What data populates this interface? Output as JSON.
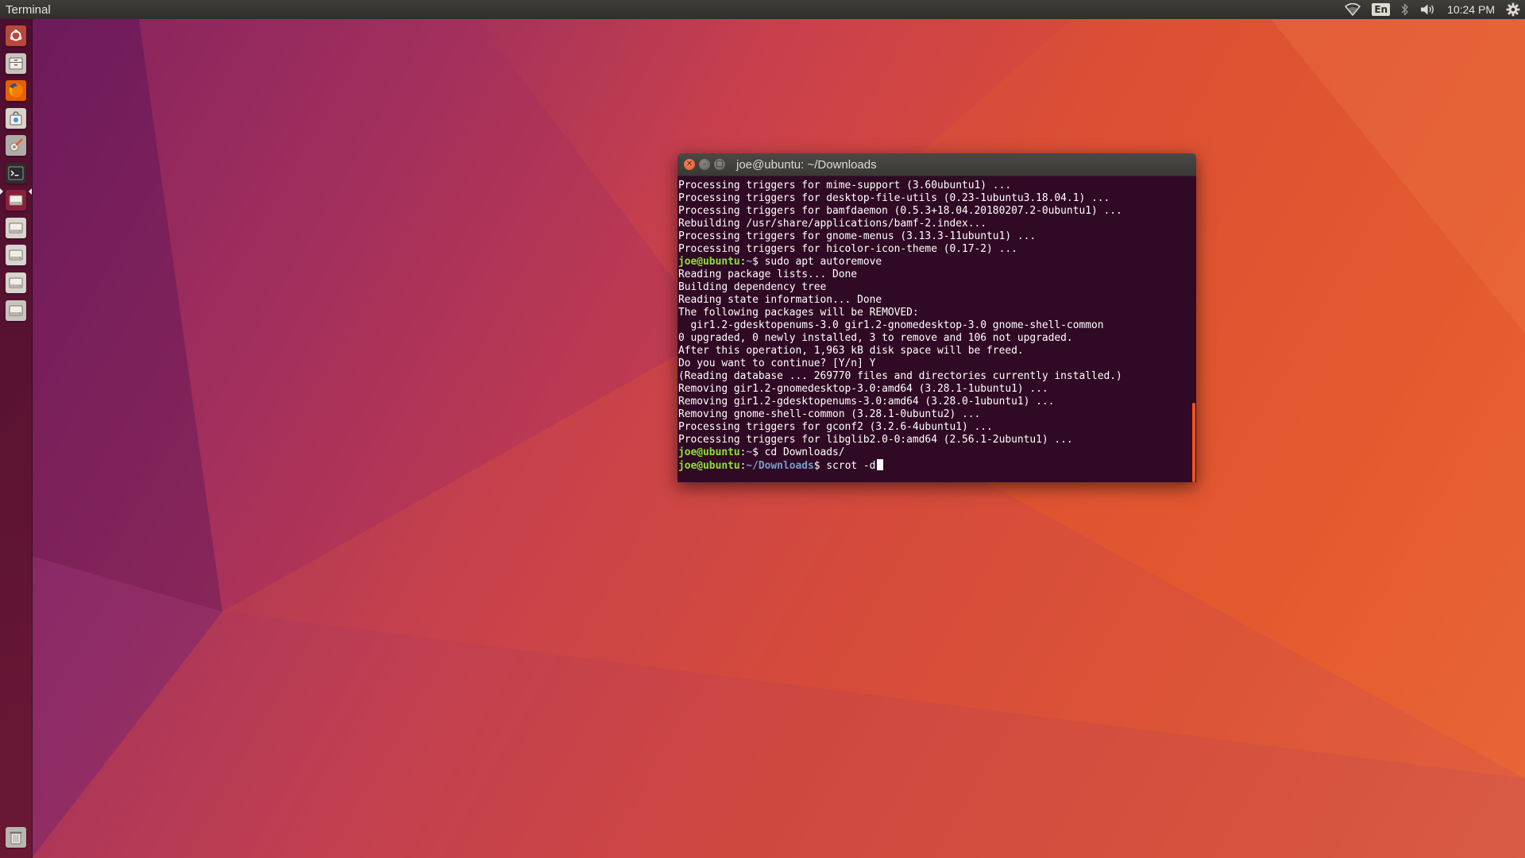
{
  "top_panel": {
    "app_title": "Terminal",
    "language": "En",
    "clock": "10:24 PM",
    "icons": [
      "wifi-icon",
      "keyboard-language-indicator",
      "bluetooth-icon",
      "volume-icon",
      "system-gear-icon"
    ]
  },
  "launcher": {
    "items": [
      {
        "name": "launcher-dash-search",
        "icon": "ubuntu-logo-icon",
        "color": "#b8493a"
      },
      {
        "name": "launcher-files",
        "icon": "file-cabinet-icon",
        "color": "#c9c4bc"
      },
      {
        "name": "launcher-firefox",
        "icon": "firefox-icon",
        "color": "#e66000"
      },
      {
        "name": "launcher-software",
        "icon": "shopping-bag-icon",
        "color": "#d8d3cc"
      },
      {
        "name": "launcher-settings",
        "icon": "wrench-gear-icon",
        "color": "#b0aca6"
      },
      {
        "name": "launcher-terminal",
        "icon": "terminal-icon",
        "color": "#2f2e2b"
      },
      {
        "name": "launcher-drive-1",
        "icon": "drive-icon",
        "color": "#8c1f3a"
      },
      {
        "name": "launcher-drive-2",
        "icon": "drive-icon",
        "color": "#d8d4ce"
      },
      {
        "name": "launcher-drive-3",
        "icon": "drive-icon",
        "color": "#d8d4ce"
      },
      {
        "name": "launcher-drive-4",
        "icon": "drive-icon",
        "color": "#d8d4ce"
      },
      {
        "name": "launcher-drive-5",
        "icon": "drive-icon",
        "color": "#c9c4bc"
      },
      {
        "name": "launcher-trash",
        "icon": "trash-icon",
        "color": "#b8b4ae"
      }
    ]
  },
  "terminal": {
    "title": "joe@ubuntu: ~/Downloads",
    "lines": [
      {
        "type": "out",
        "text": "Processing triggers for mime-support (3.60ubuntu1) ..."
      },
      {
        "type": "out",
        "text": "Processing triggers for desktop-file-utils (0.23-1ubuntu3.18.04.1) ..."
      },
      {
        "type": "out",
        "text": "Processing triggers for bamfdaemon (0.5.3+18.04.20180207.2-0ubuntu1) ..."
      },
      {
        "type": "out",
        "text": "Rebuilding /usr/share/applications/bamf-2.index..."
      },
      {
        "type": "out",
        "text": "Processing triggers for gnome-menus (3.13.3-11ubuntu1) ..."
      },
      {
        "type": "out",
        "text": "Processing triggers for hicolor-icon-theme (0.17-2) ..."
      },
      {
        "type": "prompt",
        "user": "joe@ubuntu",
        "path": "~",
        "cmd": "sudo apt autoremove"
      },
      {
        "type": "out",
        "text": "Reading package lists... Done"
      },
      {
        "type": "out",
        "text": "Building dependency tree"
      },
      {
        "type": "out",
        "text": "Reading state information... Done"
      },
      {
        "type": "out",
        "text": "The following packages will be REMOVED:"
      },
      {
        "type": "out",
        "text": "  gir1.2-gdesktopenums-3.0 gir1.2-gnomedesktop-3.0 gnome-shell-common"
      },
      {
        "type": "out",
        "text": "0 upgraded, 0 newly installed, 3 to remove and 106 not upgraded."
      },
      {
        "type": "out",
        "text": "After this operation, 1,963 kB disk space will be freed."
      },
      {
        "type": "out",
        "text": "Do you want to continue? [Y/n] Y"
      },
      {
        "type": "out",
        "text": "(Reading database ... 269770 files and directories currently installed.)"
      },
      {
        "type": "out",
        "text": "Removing gir1.2-gnomedesktop-3.0:amd64 (3.28.1-1ubuntu1) ..."
      },
      {
        "type": "out",
        "text": "Removing gir1.2-gdesktopenums-3.0:amd64 (3.28.0-1ubuntu1) ..."
      },
      {
        "type": "out",
        "text": "Removing gnome-shell-common (3.28.1-0ubuntu2) ..."
      },
      {
        "type": "out",
        "text": "Processing triggers for gconf2 (3.2.6-4ubuntu1) ..."
      },
      {
        "type": "out",
        "text": "Processing triggers for libglib2.0-0:amd64 (2.56.1-2ubuntu1) ..."
      },
      {
        "type": "prompt",
        "user": "joe@ubuntu",
        "path": "~",
        "cmd": "cd Downloads/"
      },
      {
        "type": "prompt",
        "user": "joe@ubuntu",
        "path": "~/Downloads",
        "cmd": "scrot -d"
      }
    ]
  },
  "colors": {
    "prompt_user": "#8ae234",
    "prompt_path": "#729fcf",
    "terminal_bg": "#300a24",
    "accent": "#e95420"
  }
}
